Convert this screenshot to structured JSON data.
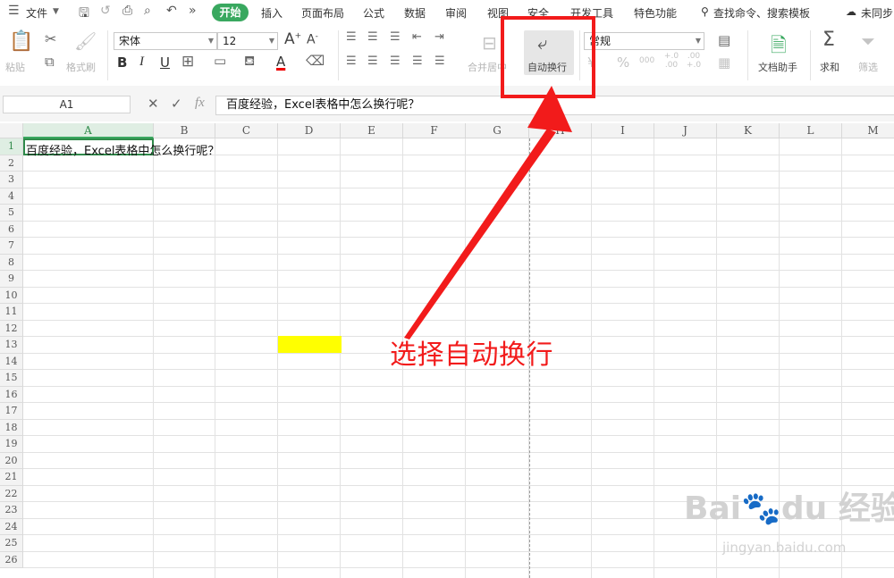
{
  "menubar": {
    "file": "文件",
    "start": "开始",
    "tabs": [
      "插入",
      "页面布局",
      "公式",
      "数据",
      "审阅",
      "视图",
      "安全",
      "开发工具",
      "特色功能"
    ],
    "search": "查找命令、搜索模板",
    "sync": "未同步"
  },
  "ribbon": {
    "paste": "粘贴",
    "format_painter": "格式刷",
    "font_name": "宋体",
    "font_size": "12",
    "bold": "B",
    "italic": "I",
    "underline": "U",
    "font_grow": "A",
    "font_shrink": "A",
    "font_color": "A",
    "merge_center": "合并居中",
    "wrap_text": "自动换行",
    "number_format": "常规",
    "percent": "%",
    "thousands": "000",
    "dec_inc": "+.0 .00",
    "dec_dec": ".00 +.0",
    "doc_helper": "文档助手",
    "sum": "求和",
    "filter": "筛选"
  },
  "formula_bar": {
    "name_box": "A1",
    "fx": "fx",
    "content": "百度经验，Excel表格中怎么换行呢？"
  },
  "grid": {
    "columns": [
      "A",
      "B",
      "C",
      "D",
      "E",
      "F",
      "G",
      "H",
      "I",
      "J",
      "K",
      "L",
      "M"
    ],
    "rows": [
      "1",
      "2",
      "3",
      "4",
      "5",
      "6",
      "7",
      "8",
      "9",
      "10",
      "11",
      "12",
      "13",
      "14",
      "15",
      "16",
      "17",
      "18",
      "19",
      "20",
      "21",
      "22",
      "23",
      "24",
      "25",
      "26"
    ],
    "a1_text": "百度经验，Excel表格中怎么换行呢？"
  },
  "annotation": {
    "text": "选择自动换行",
    "color": "#f21b1b"
  },
  "watermark": {
    "brand": "Bai",
    "brand_tail": "du",
    "brand_cn": "经验",
    "url": "jingyan.baidu.com"
  },
  "colors": {
    "accent_green": "#39a85f",
    "highlight_yellow": "#ffff00"
  }
}
